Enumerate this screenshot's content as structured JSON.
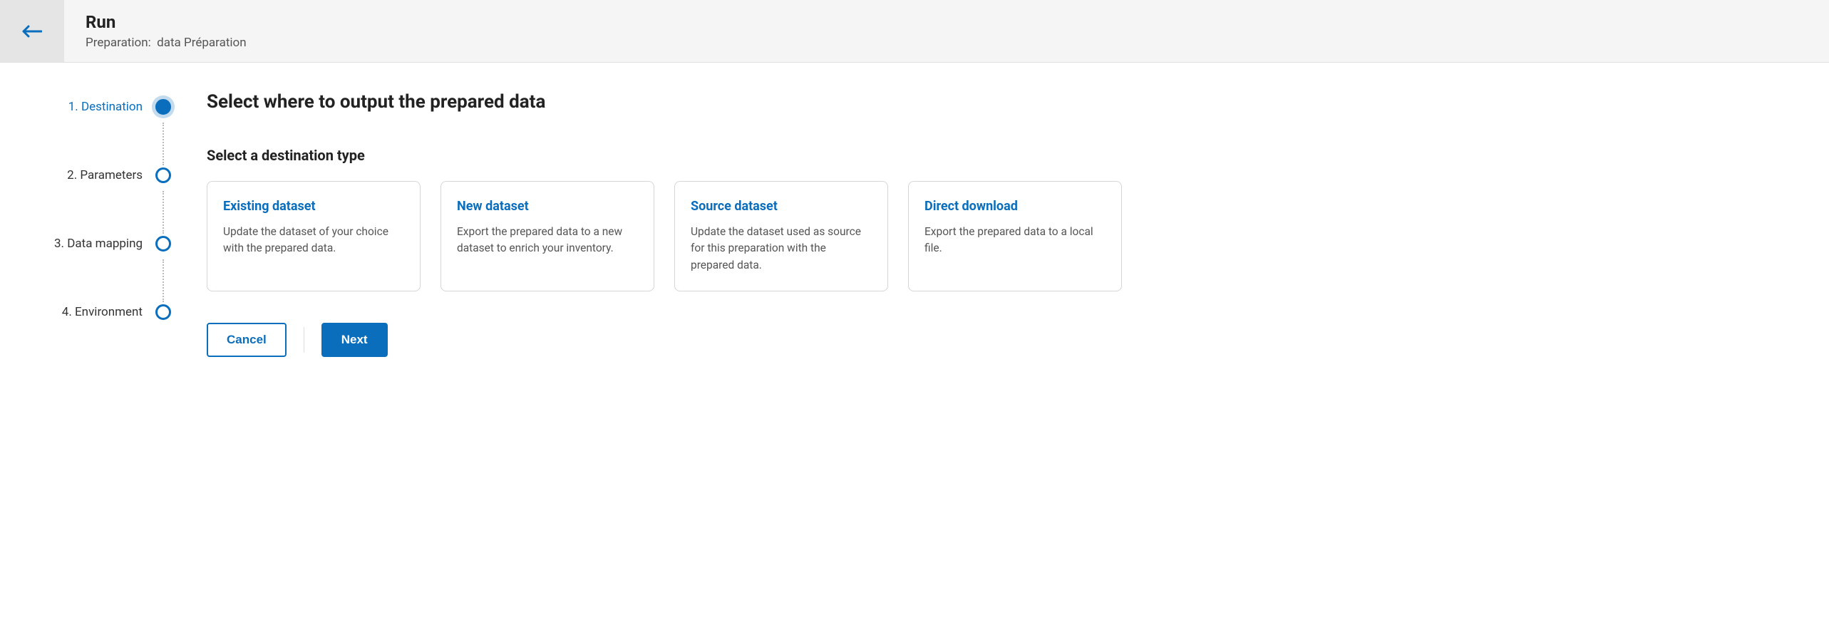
{
  "header": {
    "title": "Run",
    "sub_label": "Preparation:",
    "sub_value": "data Préparation"
  },
  "stepper": {
    "steps": [
      {
        "label": "1. Destination",
        "active": true
      },
      {
        "label": "2. Parameters",
        "active": false
      },
      {
        "label": "3. Data mapping",
        "active": false
      },
      {
        "label": "4. Environment",
        "active": false
      }
    ]
  },
  "content": {
    "title": "Select where to output the prepared data",
    "subtitle": "Select a destination type",
    "cards": [
      {
        "title": "Existing dataset",
        "desc": "Update the dataset of your choice with the prepared data."
      },
      {
        "title": "New dataset",
        "desc": "Export the prepared data to a new dataset to enrich your inventory."
      },
      {
        "title": "Source dataset",
        "desc": "Update the dataset used as source for this preparation with the prepared data."
      },
      {
        "title": "Direct download",
        "desc": "Export the prepared data to a local file."
      }
    ]
  },
  "actions": {
    "cancel": "Cancel",
    "next": "Next"
  },
  "colors": {
    "accent": "#0a6ebd"
  }
}
